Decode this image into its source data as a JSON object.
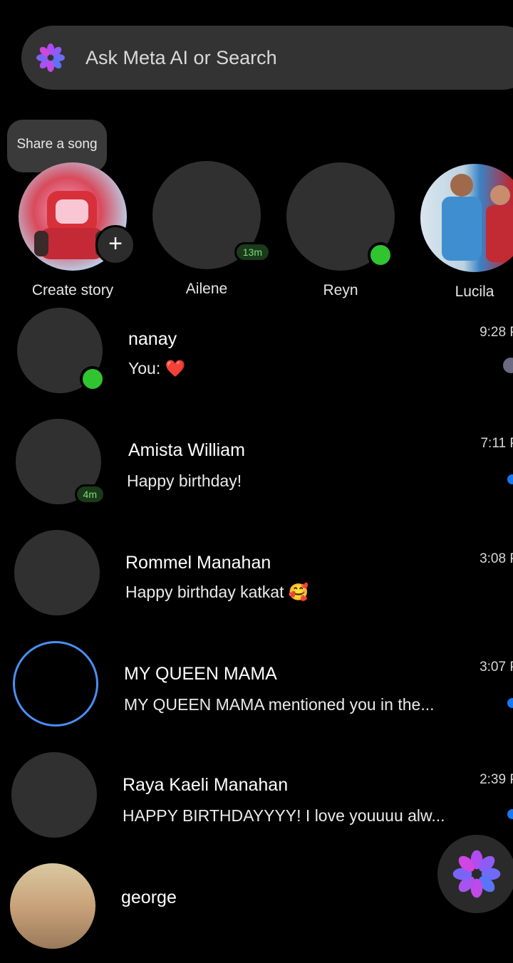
{
  "search": {
    "placeholder": "Ask Meta AI or Search",
    "icon": "meta-ai-icon"
  },
  "stories": {
    "bubble_text": "Share a song",
    "items": [
      {
        "label": "Create story",
        "badge": "+"
      },
      {
        "label": "Ailene",
        "badge": "13m"
      },
      {
        "label": "Reyn",
        "badge": "online"
      },
      {
        "label": "Lucila",
        "badge": "online"
      }
    ]
  },
  "chats": [
    {
      "name": "nanay",
      "preview": "You: ❤️",
      "time": "9:28 P",
      "status": "online"
    },
    {
      "name": "Amista William",
      "preview": "Happy birthday!",
      "time": "7:11 P",
      "status": "4m"
    },
    {
      "name": "Rommel Manahan",
      "preview": "Happy birthday katkat 🥰",
      "time": "3:08 P",
      "status": ""
    },
    {
      "name": "MY QUEEN MAMA",
      "preview": "MY QUEEN MAMA mentioned you in the...",
      "time": "3:07 P",
      "status": "story-ring"
    },
    {
      "name": "Raya Kaeli Manahan",
      "preview": "HAPPY BIRTHDAYYYY! I love youuuu alw...",
      "time": "2:39 P",
      "status": ""
    },
    {
      "name": "george",
      "preview": "",
      "time": "",
      "status": ""
    }
  ],
  "colors": {
    "accent_blue": "#1877f2",
    "online_green": "#31c431",
    "background": "#000000"
  }
}
